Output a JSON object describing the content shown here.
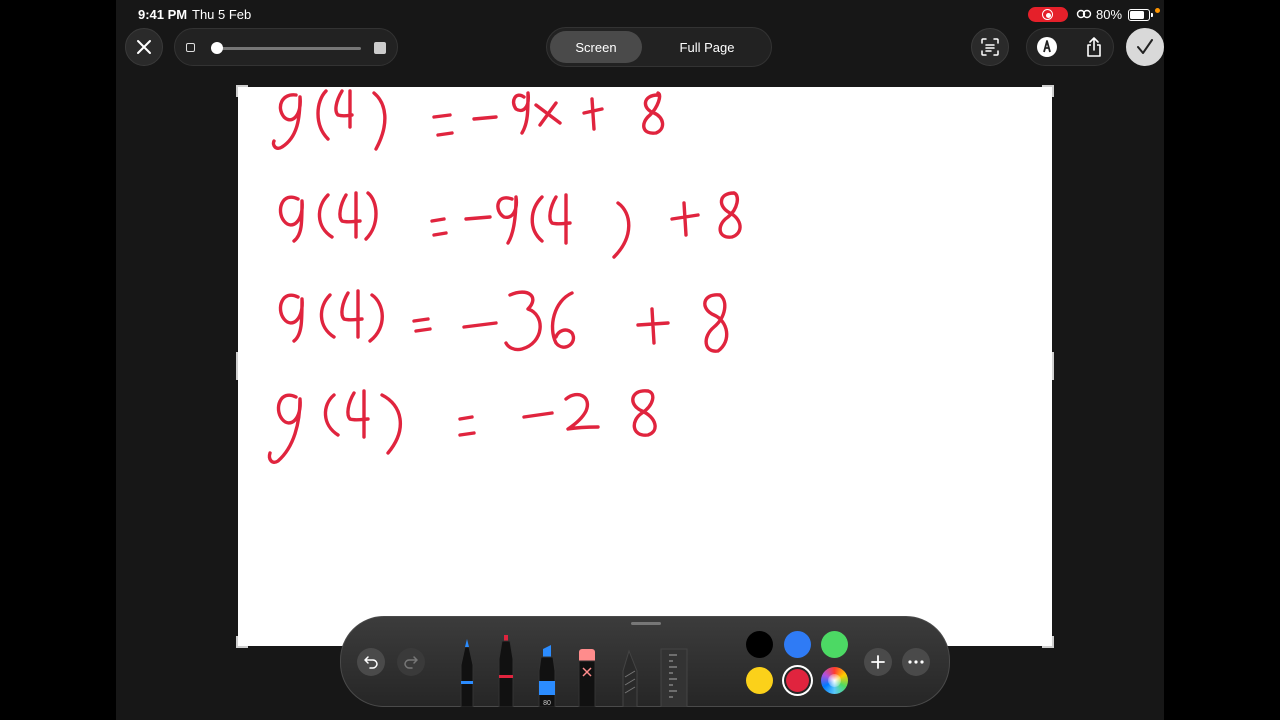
{
  "status_bar": {
    "time": "9:41 PM",
    "date": "Thu 5 Feb",
    "battery_percent": "80%",
    "battery_level": 0.8
  },
  "top_bar": {
    "tabs": [
      {
        "label": "Screen",
        "selected": true
      },
      {
        "label": "Full Page",
        "selected": false
      }
    ],
    "zoom_fraction": 0.0
  },
  "canvas": {
    "ink_color": "#e0243e",
    "handwriting_lines": [
      "g(4) = -9x + 8",
      "g(4) = -9(4) + 8",
      "g(4) = -36 + 8",
      "g(4) = -28"
    ]
  },
  "toolbar": {
    "tools": [
      {
        "name": "pen",
        "color": "#2b8cff"
      },
      {
        "name": "monoline",
        "color": "#e0243e"
      },
      {
        "name": "highlighter",
        "color": "#2b8cff",
        "label": "80"
      },
      {
        "name": "eraser",
        "color": "#ff8c8c"
      },
      {
        "name": "pencil",
        "color": "#888888"
      },
      {
        "name": "ruler",
        "color": "#555555"
      }
    ],
    "swatches": [
      {
        "name": "black",
        "color": "#000000",
        "selected": false
      },
      {
        "name": "blue",
        "color": "#2f7bf5",
        "selected": false
      },
      {
        "name": "green",
        "color": "#4cd964",
        "selected": false
      },
      {
        "name": "yellow",
        "color": "#fbd11a",
        "selected": false
      },
      {
        "name": "red",
        "color": "#e0243e",
        "selected": true
      },
      {
        "name": "color-wheel",
        "color": "multicolor",
        "selected": false
      }
    ]
  }
}
